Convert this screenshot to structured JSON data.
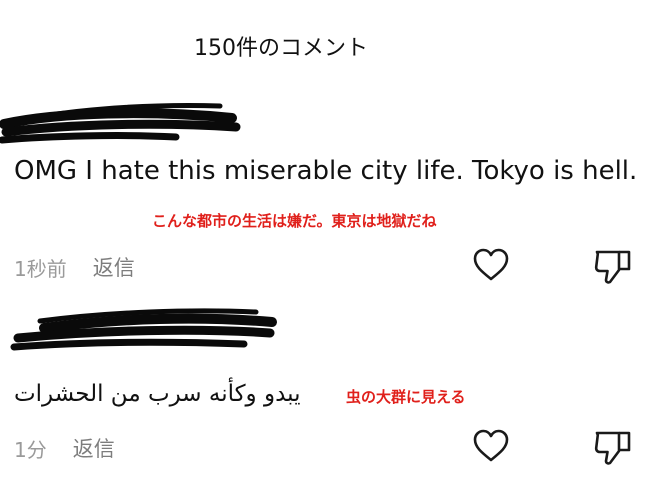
{
  "header": {
    "title": "150件のコメント"
  },
  "comments": [
    {
      "author": "",
      "text": "OMG I hate this miserable city life. Tokyo is hell.",
      "annotation": "こんな都市の生活は嫌だ。東京は地獄だね",
      "timestamp": "1秒前",
      "reply_label": "返信"
    },
    {
      "author": "",
      "text": "يبدو وكأنه سرب من الحشرات",
      "annotation": "虫の大群に見える",
      "timestamp": "1分",
      "reply_label": "返信"
    }
  ],
  "colors": {
    "annotation": "#e0201b",
    "text": "#111111",
    "muted": "#9a9a9a",
    "redaction": "#0a0a0a"
  },
  "icons": [
    "heart-icon",
    "thumbs-down-icon"
  ]
}
